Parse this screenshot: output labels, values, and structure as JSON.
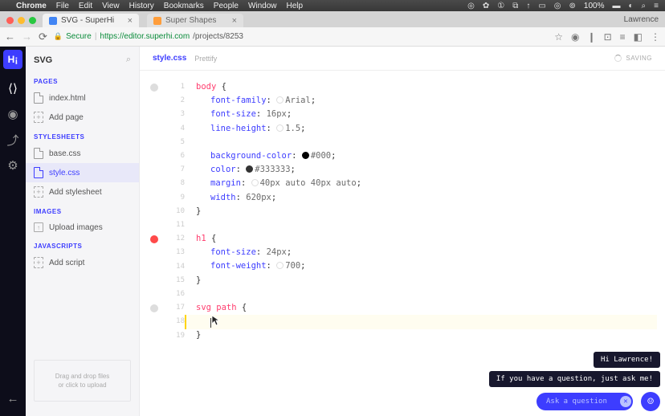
{
  "macmenu": {
    "app": "Chrome",
    "items": [
      "File",
      "Edit",
      "View",
      "History",
      "Bookmarks",
      "People",
      "Window",
      "Help"
    ],
    "battery": "100%",
    "time": ""
  },
  "chrome": {
    "tabs": [
      {
        "title": "SVG - SuperHi"
      },
      {
        "title": "Super Shapes"
      }
    ],
    "profile": "Lawrence",
    "secure_label": "Secure",
    "url_host": "https://editor.superhi.com",
    "url_path": "/projects/8253"
  },
  "sidebar": {
    "title": "SVG",
    "sections": {
      "pages": {
        "label": "PAGES",
        "items": [
          "index.html"
        ],
        "add": "Add page"
      },
      "stylesheets": {
        "label": "STYLESHEETS",
        "items": [
          "base.css",
          "style.css"
        ],
        "add": "Add stylesheet"
      },
      "images": {
        "label": "IMAGES",
        "upload": "Upload images"
      },
      "javascripts": {
        "label": "JAVASCRIPTS",
        "add": "Add script"
      }
    },
    "dropzone_l1": "Drag and drop files",
    "dropzone_l2": "or click to upload"
  },
  "editor": {
    "open_file": "style.css",
    "prettify": "Prettify",
    "status": "SAVING",
    "lines": [
      {
        "n": "1",
        "k": "rule-open",
        "sel": "body"
      },
      {
        "n": "2",
        "k": "decl",
        "prop": "font-family",
        "sw": "white",
        "val": "Arial"
      },
      {
        "n": "3",
        "k": "decl",
        "prop": "font-size",
        "val": "16px"
      },
      {
        "n": "4",
        "k": "decl",
        "prop": "line-height",
        "sw": "white",
        "val": "1.5"
      },
      {
        "n": "5",
        "k": "blank"
      },
      {
        "n": "6",
        "k": "decl",
        "prop": "background-color",
        "sw": "black",
        "val": "#000"
      },
      {
        "n": "7",
        "k": "decl",
        "prop": "color",
        "sw": "dark",
        "val": "#333333"
      },
      {
        "n": "8",
        "k": "decl",
        "prop": "margin",
        "sw": "white",
        "val": "40px auto 40px auto"
      },
      {
        "n": "9",
        "k": "decl",
        "prop": "width",
        "val": "620px"
      },
      {
        "n": "10",
        "k": "rule-close"
      },
      {
        "n": "11",
        "k": "blank"
      },
      {
        "n": "12",
        "k": "rule-open",
        "sel": "h1"
      },
      {
        "n": "13",
        "k": "decl",
        "prop": "font-size",
        "val": "24px"
      },
      {
        "n": "14",
        "k": "decl",
        "prop": "font-weight",
        "sw": "white",
        "val": "700"
      },
      {
        "n": "15",
        "k": "rule-close"
      },
      {
        "n": "16",
        "k": "blank"
      },
      {
        "n": "17",
        "k": "rule-open",
        "sel": "svg path"
      },
      {
        "n": "18",
        "k": "cursor"
      },
      {
        "n": "19",
        "k": "rule-close"
      }
    ],
    "line_dots": {
      "1": "grey",
      "12": "red",
      "17": "grey"
    },
    "current_line": 18
  },
  "chat": {
    "bubble1": "Hi Lawrence!",
    "bubble2": "If you have a question, just ask me!",
    "placeholder": "Ask a question"
  }
}
